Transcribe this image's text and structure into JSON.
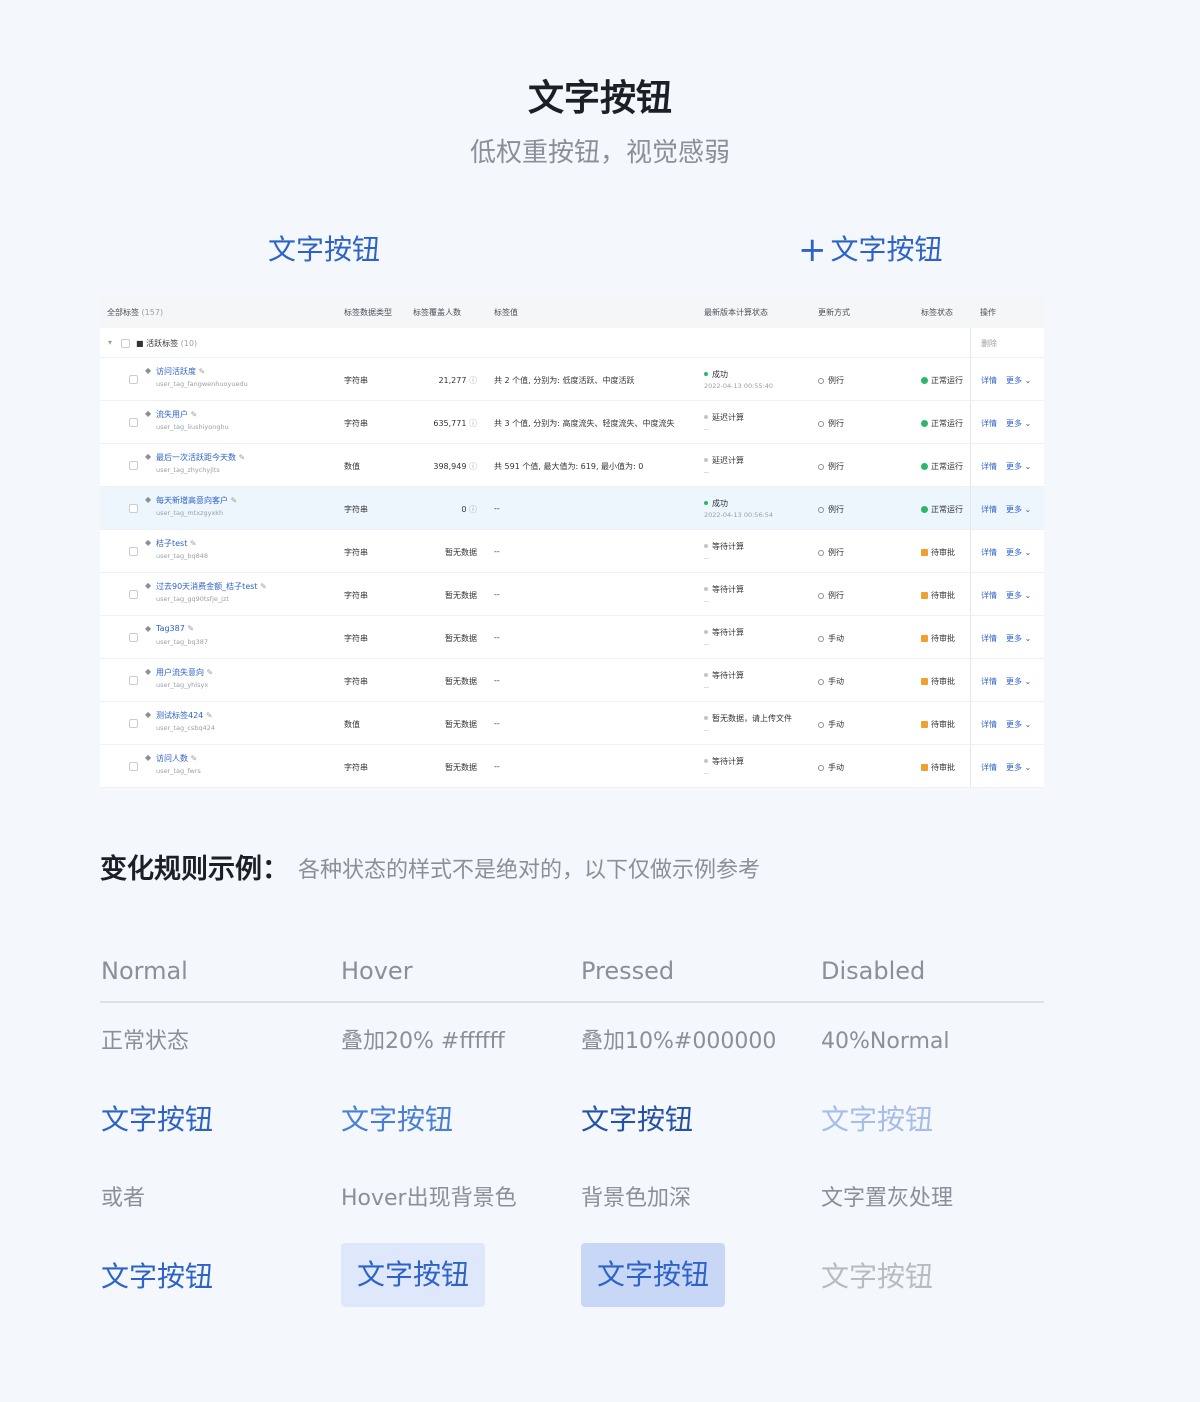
{
  "header": {
    "title": "文字按钮",
    "subtitle": "低权重按钮，视觉感弱"
  },
  "demo": {
    "button_label": "文字按钮",
    "plus_button_label": "文字按钮",
    "plus_glyph": "+"
  },
  "table": {
    "columns": {
      "all_tags": "全部标签",
      "all_tags_count": "(157)",
      "data_type": "标签数据类型",
      "coverage": "标签覆盖人数",
      "values": "标签值",
      "calc_status": "最新版本计算状态",
      "update_mode": "更新方式",
      "tag_status": "标签状态",
      "actions": "操作"
    },
    "group": {
      "label": "活跃标签",
      "count": "(10)",
      "delete": "删除"
    },
    "rows": [
      {
        "name": "访问活跃度",
        "code": "user_tag_fangwenhuoyuedu",
        "type": "字符串",
        "coverage": "21,277",
        "values": "共 2 个值, 分别为: 低度活跃、中度活跃",
        "calc": "成功",
        "calc_time": "2022-04-13 00:55:40",
        "update": "例行",
        "status": "正常运行",
        "detail": "详情",
        "more": "更多"
      },
      {
        "name": "流失用户",
        "code": "user_tag_liushiyonghu",
        "type": "字符串",
        "coverage": "635,771",
        "values": "共 3 个值, 分别为: 高度流失、轻度流失、中度流失",
        "calc": "延迟计算",
        "calc_time": "--",
        "update": "例行",
        "status": "正常运行",
        "detail": "详情",
        "more": "更多"
      },
      {
        "name": "最后一次活跃距今天数",
        "code": "user_tag_zhychyjlts",
        "type": "数值",
        "coverage": "398,949",
        "values": "共 591 个值, 最大值为: 619, 最小值为: 0",
        "calc": "延迟计算",
        "calc_time": "--",
        "update": "例行",
        "status": "正常运行",
        "detail": "详情",
        "more": "更多"
      },
      {
        "name": "每天新增高意向客户",
        "code": "user_tag_mtxzgyxkh",
        "type": "字符串",
        "coverage": "0",
        "values": "--",
        "calc": "成功",
        "calc_time": "2022-04-13 00:56:54",
        "update": "例行",
        "status": "正常运行",
        "detail": "详情",
        "more": "更多"
      },
      {
        "name": "桔子test",
        "code": "user_tag_bq848",
        "type": "字符串",
        "coverage": "暂无数据",
        "values": "--",
        "calc": "等待计算",
        "calc_time": "--",
        "update": "例行",
        "status": "待审批",
        "detail": "详情",
        "more": "更多"
      },
      {
        "name": "过去90天消费金额_桔子test",
        "code": "user_tag_gq90tsfje_jzt",
        "type": "字符串",
        "coverage": "暂无数据",
        "values": "--",
        "calc": "等待计算",
        "calc_time": "--",
        "update": "例行",
        "status": "待审批",
        "detail": "详情",
        "more": "更多"
      },
      {
        "name": "Tag387",
        "code": "user_tag_bq387",
        "type": "字符串",
        "coverage": "暂无数据",
        "values": "--",
        "calc": "等待计算",
        "calc_time": "--",
        "update": "手动",
        "status": "待审批",
        "detail": "详情",
        "more": "更多"
      },
      {
        "name": "用户流失意向",
        "code": "user_tag_yhlsyx",
        "type": "字符串",
        "coverage": "暂无数据",
        "values": "--",
        "calc": "等待计算",
        "calc_time": "--",
        "update": "手动",
        "status": "待审批",
        "detail": "详情",
        "more": "更多"
      },
      {
        "name": "测试标签424",
        "code": "user_tag_csbq424",
        "type": "数值",
        "coverage": "暂无数据",
        "values": "--",
        "calc": "暂无数据，请上传文件",
        "calc_time": "--",
        "update": "手动",
        "status": "待审批",
        "detail": "详情",
        "more": "更多"
      },
      {
        "name": "访问人数",
        "code": "user_tag_fwrs",
        "type": "字符串",
        "coverage": "暂无数据",
        "values": "--",
        "calc": "等待计算",
        "calc_time": "--",
        "update": "手动",
        "status": "待审批",
        "detail": "详情",
        "more": "更多"
      }
    ]
  },
  "rules": {
    "title": "变化规则示例：",
    "description": "各种状态的样式不是绝对的，以下仅做示例参考",
    "states": [
      "Normal",
      "Hover",
      "Pressed",
      "Disabled"
    ],
    "descriptions_1": [
      "正常状态",
      "叠加20% #ffffff",
      "叠加10%#000000",
      "40%Normal"
    ],
    "button_label": "文字按钮",
    "descriptions_2": [
      "或者",
      "Hover出现背景色",
      "背景色加深",
      "文字置灰处理"
    ]
  },
  "colors": {
    "primary": "#2d63c8",
    "background": "#f4f7fb",
    "hover_bg": "#dfe7fa",
    "pressed_bg": "#c9d7f7",
    "success": "#2fb56a",
    "pending": "#f0a030"
  }
}
